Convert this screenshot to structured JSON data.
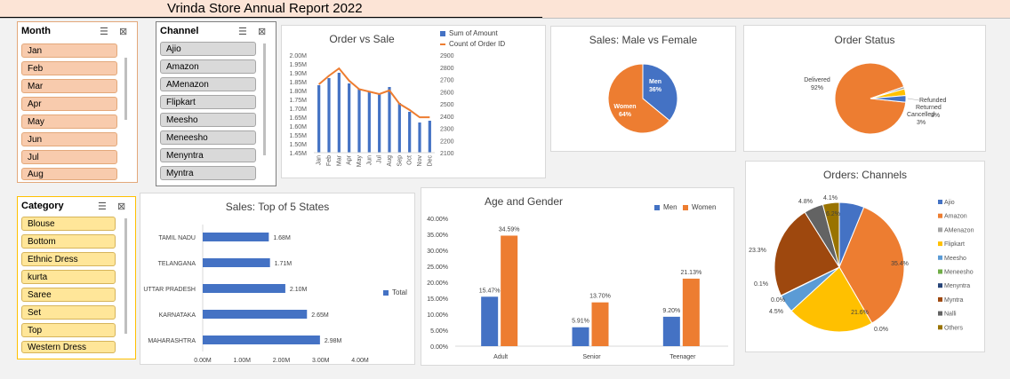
{
  "header": {
    "title": "Vrinda Store Annual Report 2022"
  },
  "month_slicer": {
    "title": "Month",
    "items": [
      "Jan",
      "Feb",
      "Mar",
      "Apr",
      "May",
      "Jun",
      "Jul",
      "Aug"
    ]
  },
  "channel_slicer": {
    "title": "Channel",
    "items": [
      "Ajio",
      "Amazon",
      "AMenazon",
      "Flipkart",
      "Meesho",
      "Meneesho",
      "Menyntra",
      "Myntra"
    ]
  },
  "category_slicer": {
    "title": "Category",
    "items": [
      "Blouse",
      "Bottom",
      "Ethnic Dress",
      "kurta",
      "Saree",
      "Set",
      "Top",
      "Western Dress"
    ]
  },
  "colors": {
    "blue": "#4472c4",
    "orange": "#ed7d31",
    "gray": "#a5a5a5",
    "yellow": "#ffc000",
    "lightblue": "#5b9bd5",
    "green": "#70ad47",
    "navy": "#264478",
    "darkbrown": "#9e480e",
    "darkgray": "#636363",
    "ochre": "#997300"
  },
  "chart_data": [
    {
      "id": "order_vs_sale",
      "type": "bar+line",
      "title": "Order vs Sale",
      "categories": [
        "Jan",
        "Feb",
        "Mar",
        "Apr",
        "May",
        "Jun",
        "Jul",
        "Aug",
        "Sep",
        "Oct",
        "Nov",
        "Dec"
      ],
      "series": [
        {
          "name": "Sum of Amount",
          "type": "bar",
          "axis": "left",
          "values": [
            1.83,
            1.87,
            1.9,
            1.84,
            1.81,
            1.79,
            1.78,
            1.82,
            1.73,
            1.68,
            1.62,
            1.63
          ]
        },
        {
          "name": "Count of Order ID",
          "type": "line",
          "axis": "right",
          "values": [
            2660,
            2730,
            2790,
            2690,
            2620,
            2600,
            2580,
            2610,
            2500,
            2450,
            2390,
            2390
          ]
        }
      ],
      "y_left_ticks": [
        "2.00M",
        "1.95M",
        "1.90M",
        "1.85M",
        "1.80M",
        "1.75M",
        "1.70M",
        "1.65M",
        "1.60M",
        "1.55M",
        "1.50M",
        "1.45M"
      ],
      "y_left_range": [
        1.45,
        2.0
      ],
      "y_right_ticks": [
        "2900",
        "2800",
        "2700",
        "2600",
        "2500",
        "2400",
        "2300",
        "2200",
        "2100"
      ],
      "y_right_range": [
        2100,
        2900
      ]
    },
    {
      "id": "sales_gender",
      "type": "pie",
      "title": "Sales: Male vs Female",
      "slices": [
        {
          "label": "Men",
          "value": 36,
          "text": "36%"
        },
        {
          "label": "Women",
          "value": 64,
          "text": "64%"
        }
      ]
    },
    {
      "id": "order_status",
      "type": "pie",
      "title": "Order Status",
      "slices": [
        {
          "label": "Delivered",
          "value": 92,
          "text": "92%"
        },
        {
          "label": "Refunded",
          "value": 1,
          "text": ""
        },
        {
          "label": "Returned",
          "value": 3,
          "text": "3%"
        },
        {
          "label": "Cancelled",
          "value": 3,
          "text": "3%"
        }
      ]
    },
    {
      "id": "top_states",
      "type": "bar",
      "orientation": "horizontal",
      "title": "Sales: Top of 5 States",
      "categories": [
        "TAMIL NADU",
        "TELANGANA",
        "UTTAR PRADESH",
        "KARNATAKA",
        "MAHARASHTRA"
      ],
      "values": [
        1.68,
        1.71,
        2.1,
        2.65,
        2.98
      ],
      "value_labels": [
        "1.68M",
        "1.71M",
        "2.10M",
        "2.65M",
        "2.98M"
      ],
      "x_ticks": [
        "0.00M",
        "1.00M",
        "2.00M",
        "3.00M",
        "4.00M"
      ],
      "xlim": [
        0,
        4
      ],
      "legend": "Total"
    },
    {
      "id": "age_gender",
      "type": "bar",
      "title": "Age and Gender",
      "categories": [
        "Adult",
        "Senior",
        "Teenager"
      ],
      "series": [
        {
          "name": "Men",
          "values": [
            15.47,
            5.91,
            9.2
          ],
          "labels": [
            "15.47%",
            "5.91%",
            "9.20%"
          ]
        },
        {
          "name": "Women",
          "values": [
            34.59,
            13.7,
            21.13
          ],
          "labels": [
            "34.59%",
            "13.70%",
            "21.13%"
          ]
        }
      ],
      "y_ticks": [
        "40.00%",
        "35.00%",
        "30.00%",
        "25.00%",
        "20.00%",
        "15.00%",
        "10.00%",
        "5.00%",
        "0.00%"
      ],
      "ylim": [
        0,
        40
      ]
    },
    {
      "id": "channels",
      "type": "pie",
      "title": "Orders: Channels",
      "slices": [
        {
          "label": "Ajio",
          "value": 6.2,
          "text": "6.2%"
        },
        {
          "label": "Amazon",
          "value": 35.4,
          "text": "35.4%"
        },
        {
          "label": "AMenazon",
          "value": 0.0,
          "text": "0.0%"
        },
        {
          "label": "Flipkart",
          "value": 21.6,
          "text": "21.6%"
        },
        {
          "label": "Meesho",
          "value": 4.5,
          "text": "4.5%"
        },
        {
          "label": "Meneesho",
          "value": 0.0,
          "text": "0.0%"
        },
        {
          "label": "Menyntra",
          "value": 0.1,
          "text": "0.1%"
        },
        {
          "label": "Myntra",
          "value": 23.3,
          "text": "23.3%"
        },
        {
          "label": "Nalli",
          "value": 4.8,
          "text": "4.8%"
        },
        {
          "label": "Others",
          "value": 4.1,
          "text": "4.1%"
        }
      ]
    }
  ]
}
